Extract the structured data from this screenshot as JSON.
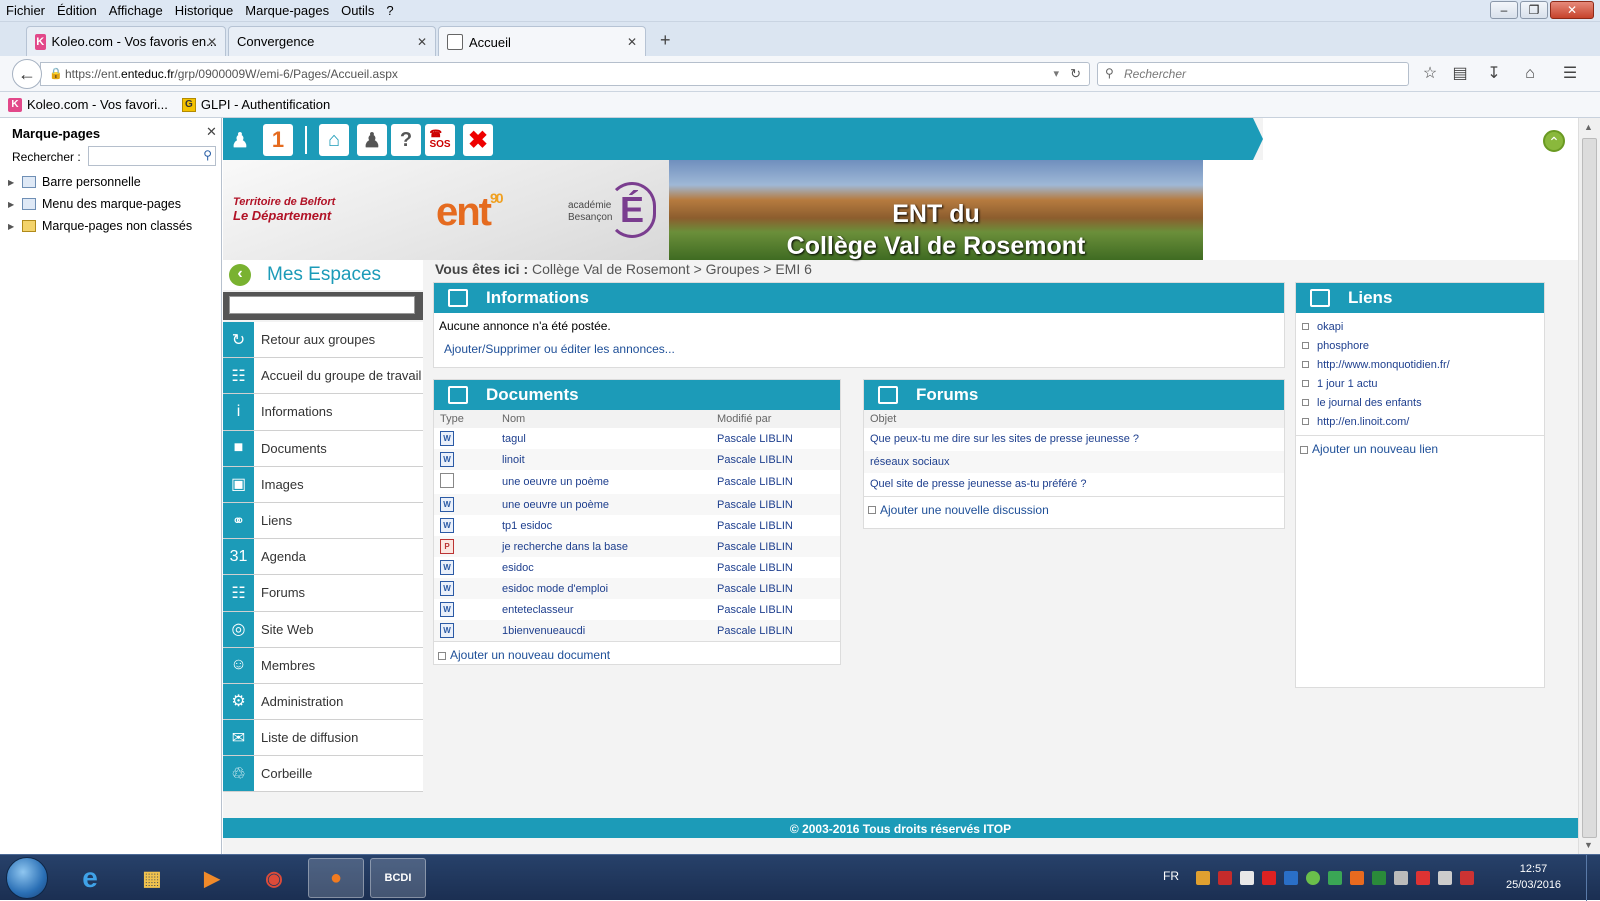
{
  "firefox": {
    "menu": [
      "Fichier",
      "Édition",
      "Affichage",
      "Historique",
      "Marque-pages",
      "Outils",
      "?"
    ],
    "tabs": [
      {
        "label": "Koleo.com - Vos favoris en..."
      },
      {
        "label": "Convergence"
      },
      {
        "label": "Accueil"
      }
    ],
    "url_prefix": "https://ent.",
    "url_host": "enteduc.fr",
    "url_rest": "/grp/0900009W/emi-6/Pages/Accueil.aspx",
    "search_placeholder": "Rechercher",
    "bookmarks": [
      "Koleo.com - Vos favori...",
      "GLPI - Authentification"
    ]
  },
  "sidebar": {
    "title": "Marque-pages",
    "search_label": "Rechercher :",
    "items": [
      "Barre personnelle",
      "Menu des marque-pages",
      "Marque-pages non classés"
    ]
  },
  "page": {
    "banner_title_line1": "ENT du",
    "banner_title_line2": "Collège Val de Rosemont",
    "logo_tb_line1": "Territoire de Belfort",
    "logo_tb_line2": "Le Département",
    "logo_ent": "ent",
    "logo_ent_num": "90",
    "logo_academie_line1": "académie",
    "logo_academie_line2": "Besançon",
    "mes_espaces": "Mes Espaces",
    "nav": [
      {
        "label": "Retour aux groupes",
        "icon": "refresh-icon"
      },
      {
        "label": "Accueil du groupe de travail",
        "icon": "org-chart-icon"
      },
      {
        "label": "Informations",
        "icon": "info-icon"
      },
      {
        "label": "Documents",
        "icon": "folder-icon"
      },
      {
        "label": "Images",
        "icon": "camera-icon"
      },
      {
        "label": "Liens",
        "icon": "link-icon"
      },
      {
        "label": "Agenda",
        "icon": "calendar-icon"
      },
      {
        "label": "Forums",
        "icon": "chat-icon"
      },
      {
        "label": "Site Web",
        "icon": "globe-icon"
      },
      {
        "label": "Membres",
        "icon": "members-icon"
      },
      {
        "label": "Administration",
        "icon": "gear-icon"
      },
      {
        "label": "Liste de diffusion",
        "icon": "mail-icon"
      },
      {
        "label": "Corbeille",
        "icon": "trash-icon"
      }
    ],
    "breadcrumb": {
      "prefix": "Vous êtes ici :",
      "path": "Collège Val de Rosemont  > Groupes  > EMI 6"
    },
    "informations": {
      "title": "Informations",
      "empty": "Aucune annonce n'a été postée.",
      "link": "Ajouter/Supprimer ou éditer les annonces..."
    },
    "documents": {
      "title": "Documents",
      "columns": [
        "Type",
        "Nom",
        "Modifié par"
      ],
      "rows": [
        {
          "type": "word",
          "name": "tagul",
          "by": "Pascale LIBLIN"
        },
        {
          "type": "word",
          "name": "linoit",
          "by": "Pascale LIBLIN"
        },
        {
          "type": "plain",
          "name": "une oeuvre un poème",
          "by": "Pascale LIBLIN"
        },
        {
          "type": "word",
          "name": "une oeuvre un poème",
          "by": "Pascale LIBLIN"
        },
        {
          "type": "word",
          "name": "tp1 esidoc",
          "by": "Pascale LIBLIN"
        },
        {
          "type": "pdf",
          "name": "je recherche dans la base",
          "by": "Pascale LIBLIN"
        },
        {
          "type": "word",
          "name": "esidoc",
          "by": "Pascale LIBLIN"
        },
        {
          "type": "word",
          "name": "esidoc mode d'emploi",
          "by": "Pascale LIBLIN"
        },
        {
          "type": "word",
          "name": "enteteclasseur",
          "by": "Pascale LIBLIN"
        },
        {
          "type": "word",
          "name": "1bienvenueaucdi",
          "by": "Pascale LIBLIN"
        }
      ],
      "add": "Ajouter un nouveau document"
    },
    "forums": {
      "title": "Forums",
      "column": "Objet",
      "rows": [
        "Que peux-tu me dire sur les sites de presse jeunesse ?",
        "réseaux sociaux",
        "Quel site de presse jeunesse as-tu préféré ?"
      ],
      "add": "Ajouter une nouvelle discussion"
    },
    "liens": {
      "title": "Liens",
      "items": [
        "okapi",
        "phosphore",
        "http://www.monquotidien.fr/",
        "1 jour 1 actu",
        "le journal des enfants",
        "http://en.linoit.com/"
      ],
      "add": "Ajouter un nouveau lien"
    },
    "footer": "© 2003-2016 Tous droits réservés ITOP"
  },
  "taskbar": {
    "lang": "FR",
    "time": "12:57",
    "date": "25/03/2016",
    "bcdi": "BCDI"
  },
  "colors": {
    "accent": "#1c9bb8",
    "link": "#1e3f8e"
  }
}
